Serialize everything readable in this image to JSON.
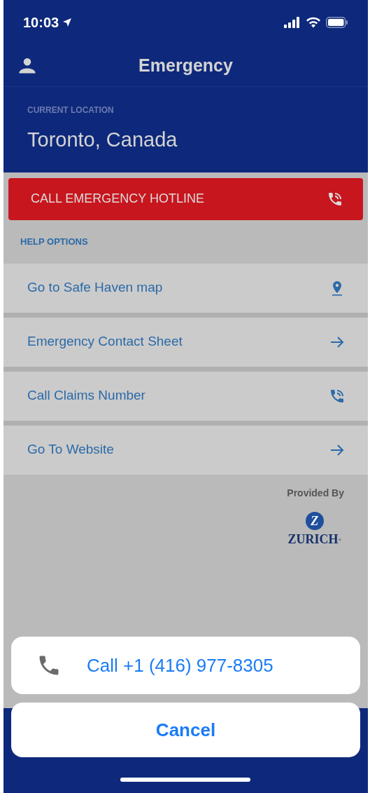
{
  "status_bar": {
    "time": "10:03"
  },
  "nav": {
    "title": "Emergency"
  },
  "location": {
    "label": "CURRENT LOCATION",
    "value": "Toronto, Canada"
  },
  "hotline_button": {
    "label": "CALL EMERGENCY HOTLINE"
  },
  "help_options": {
    "label": "HELP OPTIONS",
    "items": [
      {
        "label": "Go to Safe Haven map",
        "kind": "pin"
      },
      {
        "label": "Emergency Contact Sheet",
        "kind": "arrow"
      },
      {
        "label": "Call Claims Number",
        "kind": "phone"
      },
      {
        "label": "Go To Website",
        "kind": "arrow"
      }
    ]
  },
  "provider": {
    "label": "Provided By",
    "logo_mark": "Z",
    "logo_name": "ZURICH",
    "logo_registered": "®"
  },
  "action_sheet": {
    "call": "Call +1 (416) 977-8305",
    "cancel": "Cancel"
  }
}
